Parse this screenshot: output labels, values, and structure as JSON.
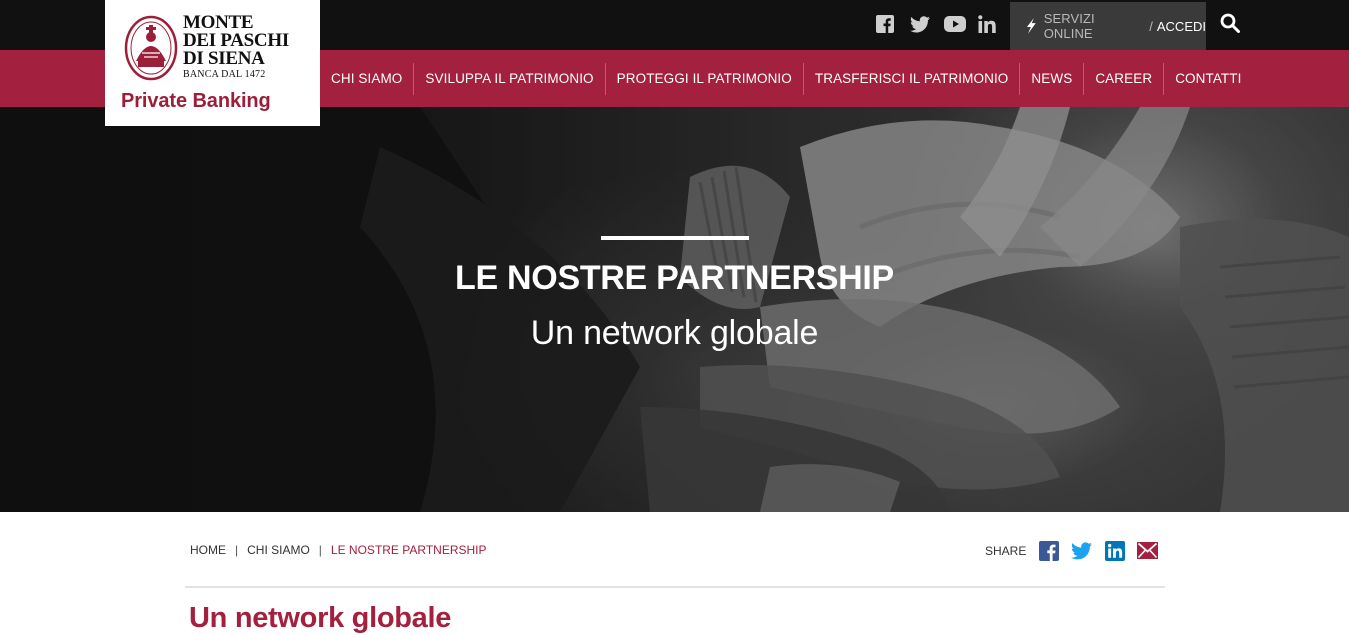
{
  "header": {
    "social_icons": [
      "facebook-icon",
      "twitter-icon",
      "youtube-icon",
      "linkedin-icon"
    ],
    "login": {
      "services_label": "SERVIZI ONLINE",
      "separator": "/",
      "access_label": "ACCEDI"
    },
    "search_icon": "search-icon"
  },
  "logo": {
    "line1": "MONTE",
    "line2": "DEI PASCHI",
    "line3": "DI SIENA",
    "tagline": "BANCA DAL 1472",
    "product": "Private Banking"
  },
  "nav": {
    "items": [
      {
        "label": "CHI SIAMO"
      },
      {
        "label": "SVILUPPA IL PATRIMONIO"
      },
      {
        "label": "PROTEGGI IL PATRIMONIO"
      },
      {
        "label": "TRASFERISCI IL PATRIMONIO"
      },
      {
        "label": "NEWS"
      },
      {
        "label": "CAREER"
      },
      {
        "label": "CONTATTI"
      }
    ]
  },
  "hero": {
    "title": "LE NOSTRE PARTNERSHIP",
    "subtitle": "Un network globale"
  },
  "breadcrumb": {
    "items": [
      "HOME",
      "CHI SIAMO",
      "LE NOSTRE PARTNERSHIP"
    ],
    "separator": "|"
  },
  "share": {
    "label": "SHARE",
    "icons": [
      "facebook-icon",
      "twitter-icon",
      "linkedin-icon",
      "email-icon"
    ]
  },
  "content": {
    "section_title": "Un network globale"
  },
  "colors": {
    "brand_red": "#a3203e",
    "topbar": "#111111",
    "login_box": "#3a3a3a",
    "facebook": "#3b5998",
    "twitter": "#1da1f2",
    "linkedin": "#0077b5"
  }
}
